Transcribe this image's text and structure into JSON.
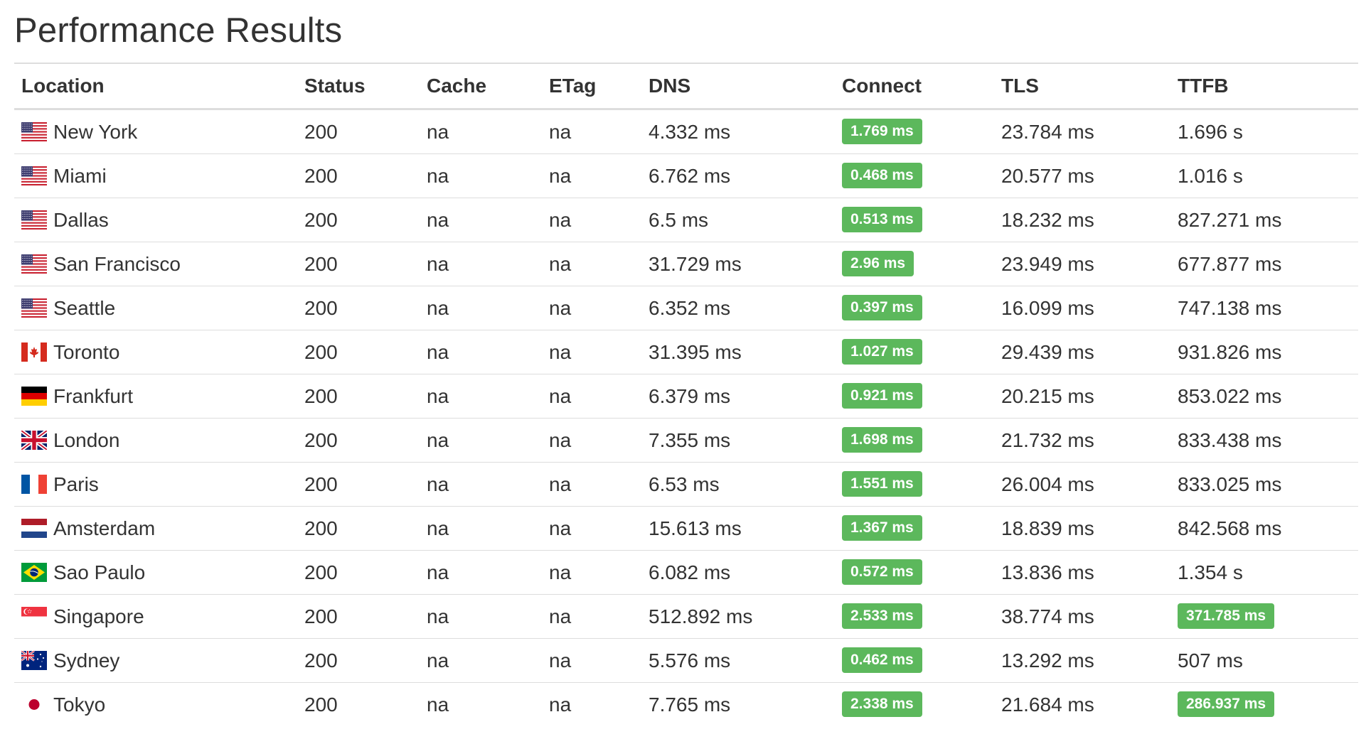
{
  "page": {
    "title": "Performance Results"
  },
  "colors": {
    "badge_green": "#5cb85c",
    "text": "#333333",
    "border": "#dddddd"
  },
  "table": {
    "headers": {
      "location": "Location",
      "status": "Status",
      "cache": "Cache",
      "etag": "ETag",
      "dns": "DNS",
      "connect": "Connect",
      "tls": "TLS",
      "ttfb": "TTFB"
    },
    "rows": [
      {
        "flag": "us-flag-icon",
        "location": "New York",
        "status": "200",
        "cache": "na",
        "etag": "na",
        "dns": "4.332 ms",
        "connect": "1.769 ms",
        "connect_highlight": true,
        "tls": "23.784 ms",
        "ttfb": "1.696 s",
        "ttfb_highlight": false
      },
      {
        "flag": "us-flag-icon",
        "location": "Miami",
        "status": "200",
        "cache": "na",
        "etag": "na",
        "dns": "6.762 ms",
        "connect": "0.468 ms",
        "connect_highlight": true,
        "tls": "20.577 ms",
        "ttfb": "1.016 s",
        "ttfb_highlight": false
      },
      {
        "flag": "us-flag-icon",
        "location": "Dallas",
        "status": "200",
        "cache": "na",
        "etag": "na",
        "dns": "6.5 ms",
        "connect": "0.513 ms",
        "connect_highlight": true,
        "tls": "18.232 ms",
        "ttfb": "827.271 ms",
        "ttfb_highlight": false
      },
      {
        "flag": "us-flag-icon",
        "location": "San Francisco",
        "status": "200",
        "cache": "na",
        "etag": "na",
        "dns": "31.729 ms",
        "connect": "2.96 ms",
        "connect_highlight": true,
        "tls": "23.949 ms",
        "ttfb": "677.877 ms",
        "ttfb_highlight": false
      },
      {
        "flag": "us-flag-icon",
        "location": "Seattle",
        "status": "200",
        "cache": "na",
        "etag": "na",
        "dns": "6.352 ms",
        "connect": "0.397 ms",
        "connect_highlight": true,
        "tls": "16.099 ms",
        "ttfb": "747.138 ms",
        "ttfb_highlight": false
      },
      {
        "flag": "ca-flag-icon",
        "location": "Toronto",
        "status": "200",
        "cache": "na",
        "etag": "na",
        "dns": "31.395 ms",
        "connect": "1.027 ms",
        "connect_highlight": true,
        "tls": "29.439 ms",
        "ttfb": "931.826 ms",
        "ttfb_highlight": false
      },
      {
        "flag": "de-flag-icon",
        "location": "Frankfurt",
        "status": "200",
        "cache": "na",
        "etag": "na",
        "dns": "6.379 ms",
        "connect": "0.921 ms",
        "connect_highlight": true,
        "tls": "20.215 ms",
        "ttfb": "853.022 ms",
        "ttfb_highlight": false
      },
      {
        "flag": "gb-flag-icon",
        "location": "London",
        "status": "200",
        "cache": "na",
        "etag": "na",
        "dns": "7.355 ms",
        "connect": "1.698 ms",
        "connect_highlight": true,
        "tls": "21.732 ms",
        "ttfb": "833.438 ms",
        "ttfb_highlight": false
      },
      {
        "flag": "fr-flag-icon",
        "location": "Paris",
        "status": "200",
        "cache": "na",
        "etag": "na",
        "dns": "6.53 ms",
        "connect": "1.551 ms",
        "connect_highlight": true,
        "tls": "26.004 ms",
        "ttfb": "833.025 ms",
        "ttfb_highlight": false
      },
      {
        "flag": "nl-flag-icon",
        "location": "Amsterdam",
        "status": "200",
        "cache": "na",
        "etag": "na",
        "dns": "15.613 ms",
        "connect": "1.367 ms",
        "connect_highlight": true,
        "tls": "18.839 ms",
        "ttfb": "842.568 ms",
        "ttfb_highlight": false
      },
      {
        "flag": "br-flag-icon",
        "location": "Sao Paulo",
        "status": "200",
        "cache": "na",
        "etag": "na",
        "dns": "6.082 ms",
        "connect": "0.572 ms",
        "connect_highlight": true,
        "tls": "13.836 ms",
        "ttfb": "1.354 s",
        "ttfb_highlight": false
      },
      {
        "flag": "sg-flag-icon",
        "location": "Singapore",
        "status": "200",
        "cache": "na",
        "etag": "na",
        "dns": "512.892 ms",
        "connect": "2.533 ms",
        "connect_highlight": true,
        "tls": "38.774 ms",
        "ttfb": "371.785 ms",
        "ttfb_highlight": true
      },
      {
        "flag": "au-flag-icon",
        "location": "Sydney",
        "status": "200",
        "cache": "na",
        "etag": "na",
        "dns": "5.576 ms",
        "connect": "0.462 ms",
        "connect_highlight": true,
        "tls": "13.292 ms",
        "ttfb": "507 ms",
        "ttfb_highlight": false
      },
      {
        "flag": "jp-flag-icon",
        "location": "Tokyo",
        "status": "200",
        "cache": "na",
        "etag": "na",
        "dns": "7.765 ms",
        "connect": "2.338 ms",
        "connect_highlight": true,
        "tls": "21.684 ms",
        "ttfb": "286.937 ms",
        "ttfb_highlight": true
      }
    ]
  }
}
